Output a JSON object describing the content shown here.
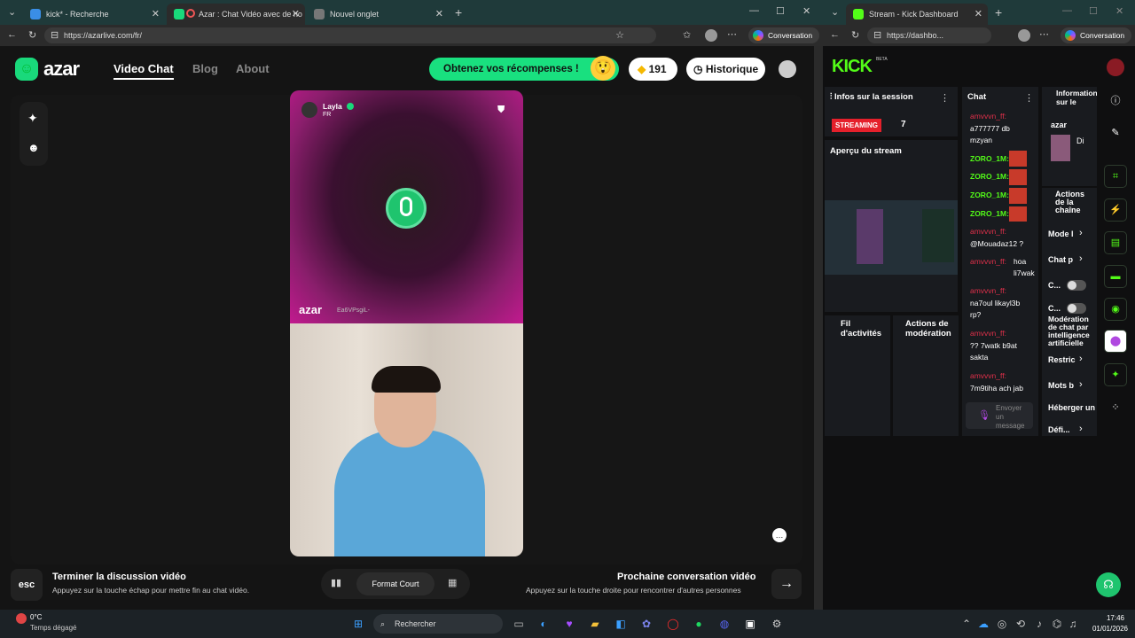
{
  "left_browser": {
    "tabs": [
      {
        "title": "kick* - Recherche"
      },
      {
        "title": "Azar : Chat Vidéo avec de no"
      },
      {
        "title": "Nouvel onglet"
      }
    ],
    "url": "https://azarlive.com/fr/",
    "conversation_label": "Conversation"
  },
  "azar": {
    "logo": "azar",
    "nav": [
      "Video Chat",
      "Blog",
      "About"
    ],
    "rewards_label": "Obtenez vos récompenses !",
    "gems": "191",
    "history_label": "Historique",
    "peer": {
      "name": "Layla",
      "country": "FR"
    },
    "watermark": "azar",
    "watermark_id": "Ea6VPsgiL-",
    "end_title": "Terminer la discussion vidéo",
    "end_desc": "Appuyez sur la touche échap pour mettre fin au chat vidéo.",
    "esc_label": "esc",
    "format_label": "Format Court",
    "next_title": "Prochaine conversation vidéo",
    "next_desc": "Appuyez sur la touche droite pour rencontrer d'autres personnes"
  },
  "right_browser": {
    "tab_title": "Stream - Kick Dashboard",
    "url": "https://dashbo...",
    "conversation_label": "Conversation",
    "kick_logo": "KICK",
    "beta": "BETA",
    "session_title": "Infos sur la session",
    "streaming_badge": "STREAMING",
    "viewer_count": "7",
    "preview_title": "Aperçu du stream",
    "activity_title": "Fil d'activités",
    "moderation_title": "Actions de modération",
    "chat_title": "Chat",
    "chat": [
      {
        "user": "amvvvn_ff:",
        "msg": "a777777 db mzyan"
      },
      {
        "user": "ZORO_1M:",
        "msg": ""
      },
      {
        "user": "ZORO_1M:",
        "msg": ""
      },
      {
        "user": "ZORO_1M:",
        "msg": ""
      },
      {
        "user": "ZORO_1M:",
        "msg": ""
      },
      {
        "user": "amvvvn_ff:",
        "msg": "@Mouadaz12 ?"
      },
      {
        "user": "amvvvn_ff:",
        "msg": "hoa li7wak"
      },
      {
        "user": "amvvvn_ff:",
        "msg": "na7oul likayl3b rp?"
      },
      {
        "user": "amvvvn_ff:",
        "msg": "?? 7watk b9at sakta"
      },
      {
        "user": "amvvvn_ff:",
        "msg": "7m9tiha ach jab"
      }
    ],
    "chat_placeholder": "Envoyer un message",
    "info_title": "Informations sur le stream",
    "info_channel": "azar",
    "info_short": "Di",
    "actions_title": "Actions de la chaîne",
    "actions": [
      "Mode l",
      "Chat p",
      "C...",
      "C...",
      "Modération de chat par intelligence artificielle",
      "Restric",
      "Mots b",
      "Héberger un",
      "Défi..."
    ]
  },
  "taskbar": {
    "temp": "0°C",
    "weather": "Temps dégagé",
    "search": "Rechercher",
    "time": "17:46",
    "date": "01/01/2026"
  }
}
